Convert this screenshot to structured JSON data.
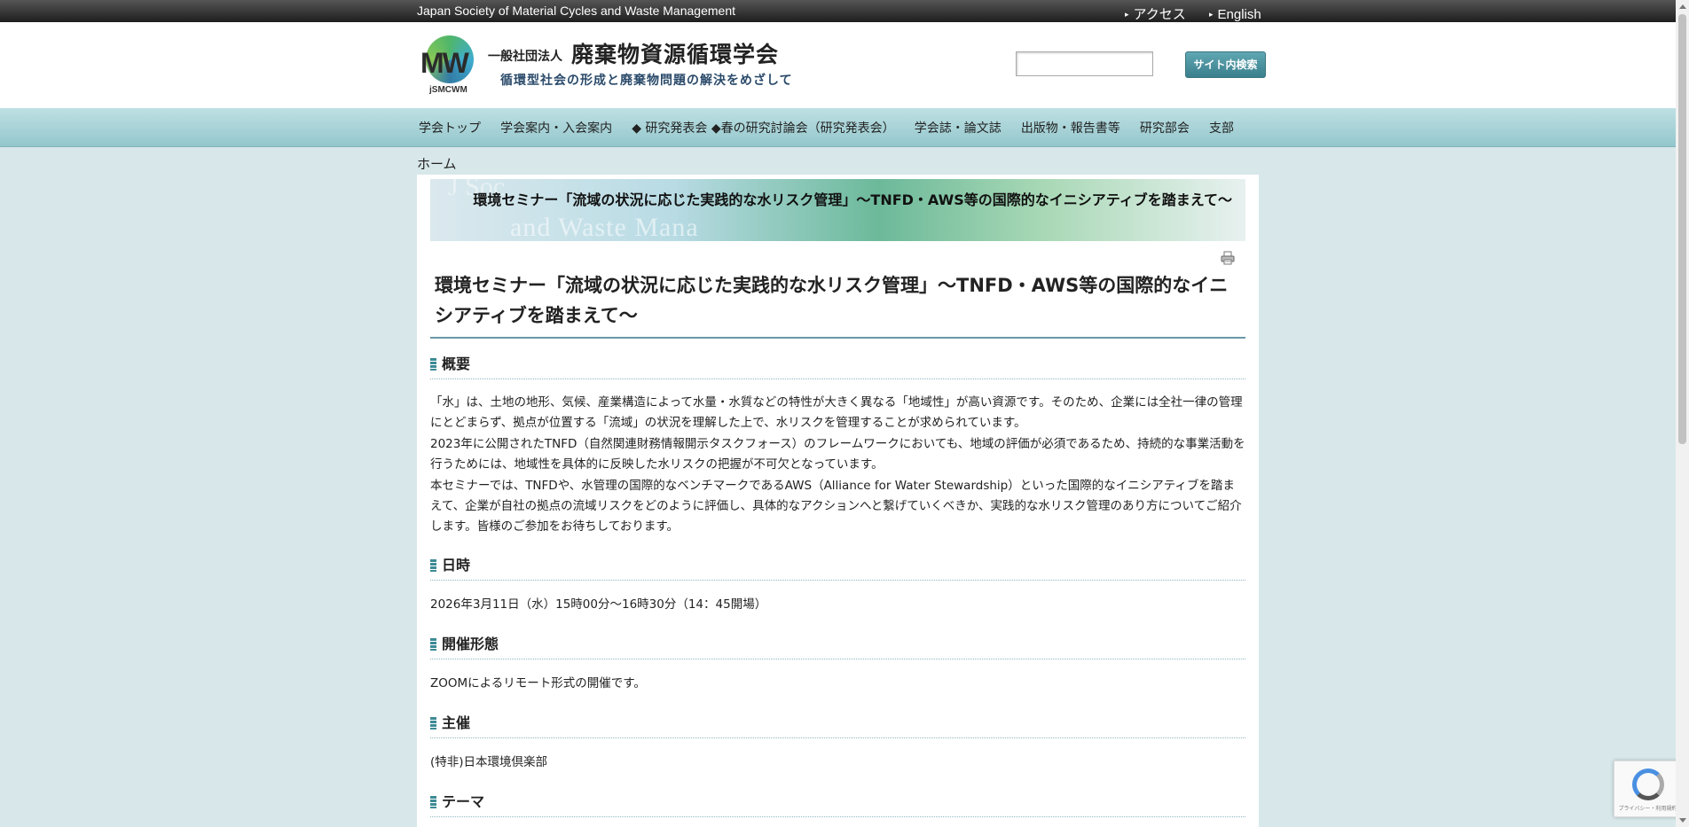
{
  "topbar": {
    "org_name_en": "Japan Society of Material Cycles and Waste Management",
    "links": [
      "アクセス",
      "English"
    ]
  },
  "header": {
    "logo_text": "MW",
    "logo_abbr": "jSMCWM",
    "org_type": "一般社団法人",
    "org_name": "廃棄物資源循環学会",
    "tagline": "循環型社会の形成と廃棄物問題の解決をめざして",
    "search": {
      "value": "",
      "button_label": "サイト内検索"
    }
  },
  "nav": {
    "items": [
      "学会トップ",
      "学会案内・入会案内",
      "◆ 研究発表会 ◆春の研究討論会（研究発表会）",
      "学会誌・論文誌",
      "出版物・報告書等",
      "研究部会",
      "支部"
    ]
  },
  "breadcrumb": "ホーム",
  "banner": {
    "ghost_text_top": "J Soc",
    "ghost_text_bottom": "and Waste Mana",
    "title": "環境セミナー「流域の状況に応じた実践的な水リスク管理」～TNFD・AWS等の国際的なイニシアティブを踏まえて～"
  },
  "page": {
    "title": "環境セミナー「流域の状況に応じた実践的な水リスク管理」～TNFD・AWS等の国際的なイニシアティブを踏まえて～",
    "sections": [
      {
        "heading": "概要",
        "paragraphs": [
          "「水」は、土地の地形、気候、産業構造によって水量・水質などの特性が大きく異なる「地域性」が高い資源です。そのため、企業には全社一律の管理にとどまらず、拠点が位置する「流域」の状況を理解した上で、水リスクを管理することが求められています。",
          "2023年に公開されたTNFD（自然関連財務情報開示タスクフォース）のフレームワークにおいても、地域の評価が必須であるため、持続的な事業活動を行うためには、地域性を具体的に反映した水リスクの把握が不可欠となっています。",
          "本セミナーでは、TNFDや、水管理の国際的なベンチマークであるAWS（Alliance for Water Stewardship）といった国際的なイニシアティブを踏まえて、企業が自社の拠点の流域リスクをどのように評価し、具体的なアクションへと繋げていくべきか、実践的な水リスク管理のあり方についてご紹介します。皆様のご参加をお待ちしております。"
        ]
      },
      {
        "heading": "日時",
        "paragraphs": [
          "2026年3月11日（水）15時00分～16時30分（14：45開場）"
        ]
      },
      {
        "heading": "開催形態",
        "paragraphs": [
          "ZOOMによるリモート形式の開催です。"
        ]
      },
      {
        "heading": "主催",
        "paragraphs": [
          "(特非)日本環境倶楽部"
        ]
      },
      {
        "heading": "テーマ",
        "paragraphs": []
      }
    ]
  },
  "recaptcha": {
    "text": "プライバシー・利用規約"
  }
}
